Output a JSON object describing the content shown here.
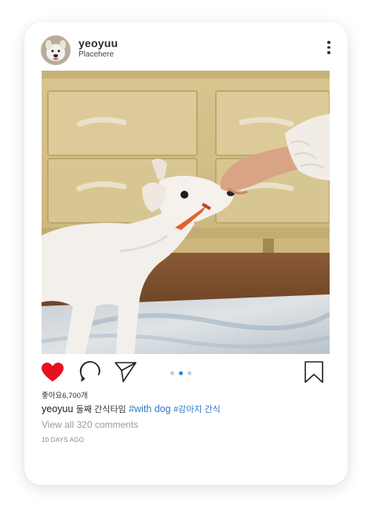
{
  "post": {
    "username": "yeoyuu",
    "location": "Placehere",
    "likes_text": "좋아요6,700개",
    "caption_user": "yeoyuu",
    "caption_text": "둘째 간식타임",
    "hashtags": [
      "#with dog",
      "#강아지 간식"
    ],
    "view_comments": "View all 320 comments",
    "time_ago": "10 DAYS AGO",
    "carousel_total": 3,
    "carousel_active": 2,
    "liked": true
  },
  "icons": {
    "like": "heart-icon",
    "comment": "comment-bubble-icon",
    "share": "paper-plane-icon",
    "save": "bookmark-icon",
    "more": "more-vertical-icon"
  },
  "colors": {
    "like_red": "#e8101f",
    "hashtag_blue": "#2d78c8",
    "carousel_active": "#1d8be0",
    "carousel_inactive": "#c9c9c9"
  }
}
